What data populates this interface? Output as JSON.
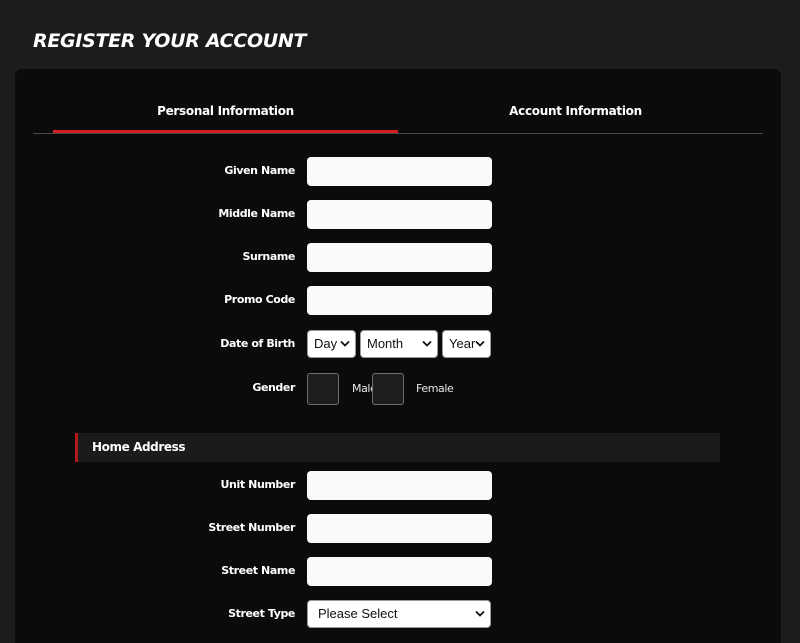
{
  "page": {
    "title": "REGISTER YOUR ACCOUNT"
  },
  "tabs": [
    {
      "label": "Personal Information",
      "active": true
    },
    {
      "label": "Account Information",
      "active": false
    }
  ],
  "personal": {
    "given_name": {
      "label": "Given Name",
      "value": ""
    },
    "middle_name": {
      "label": "Middle Name",
      "value": ""
    },
    "surname": {
      "label": "Surname",
      "value": ""
    },
    "promo_code": {
      "label": "Promo Code",
      "value": ""
    },
    "dob": {
      "label": "Date of Birth",
      "day": "Day",
      "month": "Month",
      "year": "Year"
    },
    "gender": {
      "label": "Gender",
      "male": "Male",
      "female": "Female"
    }
  },
  "home_address": {
    "title": "Home Address",
    "unit_number": {
      "label": "Unit Number",
      "value": ""
    },
    "street_number": {
      "label": "Street Number",
      "value": ""
    },
    "street_name": {
      "label": "Street Name",
      "value": ""
    },
    "street_type": {
      "label": "Street Type",
      "selected": "Please Select"
    }
  },
  "colors": {
    "accent": "#d22020",
    "panel": "#0b0b0b",
    "background": "#1c1c1c"
  },
  "icons": {
    "select_arrow": "chevron-down-icon"
  }
}
